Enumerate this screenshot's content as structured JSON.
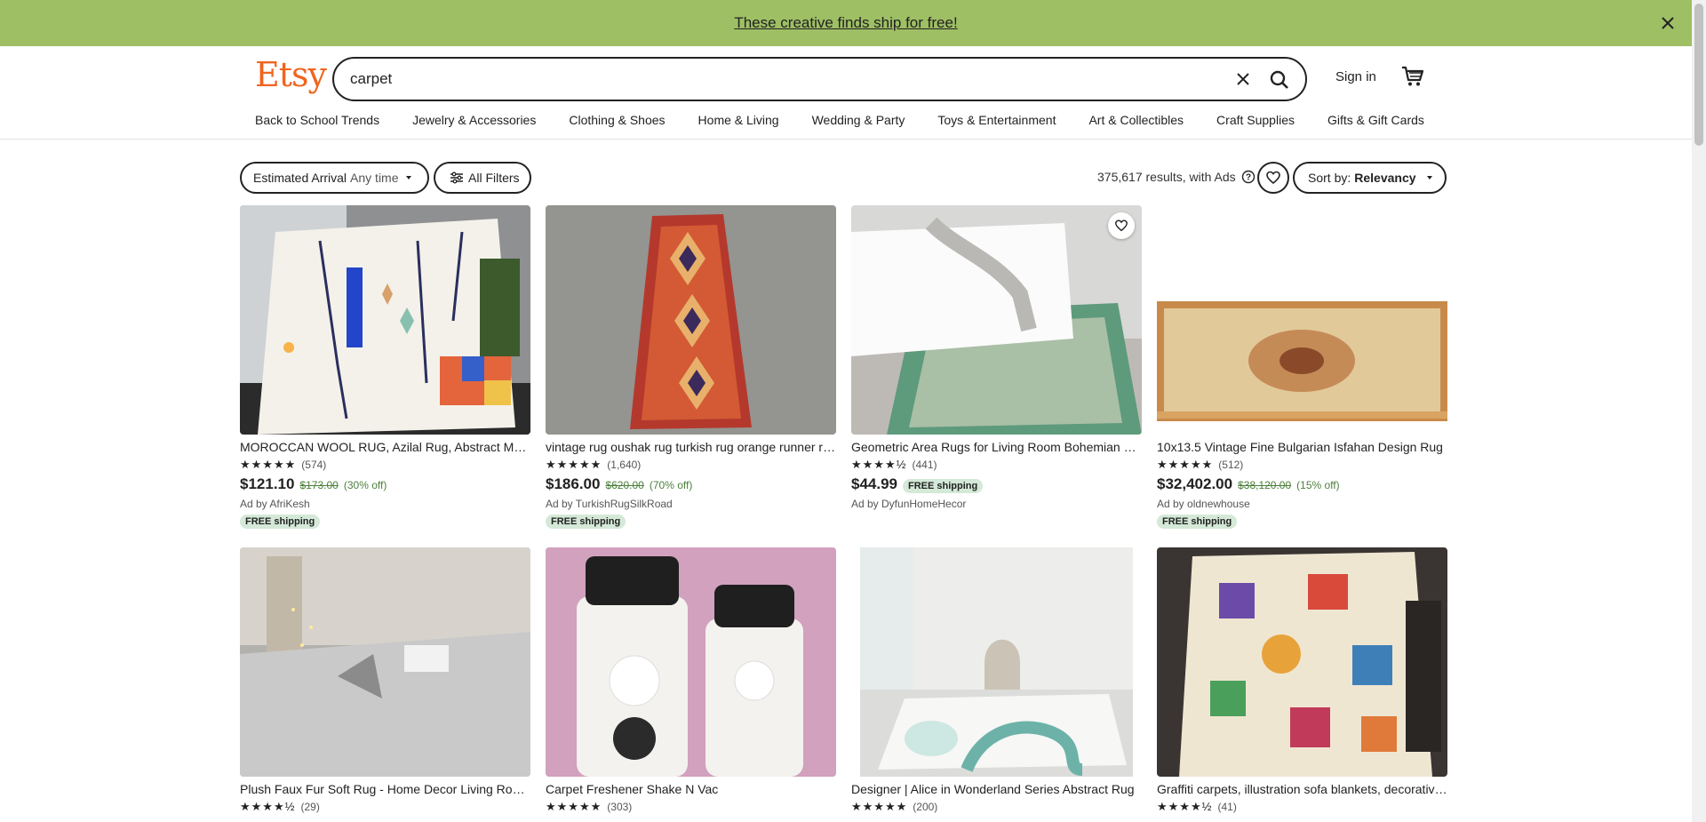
{
  "banner": {
    "text": "These creative finds ship for free!"
  },
  "header": {
    "logo": "Etsy",
    "search_value": "carpet",
    "sign_in": "Sign in"
  },
  "nav": [
    "Back to School Trends",
    "Jewelry & Accessories",
    "Clothing & Shoes",
    "Home & Living",
    "Wedding & Party",
    "Toys & Entertainment",
    "Art & Collectibles",
    "Craft Supplies",
    "Gifts & Gift Cards"
  ],
  "toolbar": {
    "arrival_label": "Estimated Arrival",
    "arrival_value": "Any time",
    "filters_label": "All Filters",
    "results_text": "375,617 results, with Ads",
    "sort_label": "Sort by:",
    "sort_value": "Relevancy"
  },
  "listings": [
    {
      "title": "MOROCCAN WOOL RUG, Azilal Rug, Abstract Moroccan Rug",
      "stars": "★★★★★",
      "reviews": "(574)",
      "price": "$121.10",
      "orig": "$173.00",
      "off": "(30% off)",
      "shop": "Ad by AfriKesh",
      "ship": "FREE shipping",
      "ship_inline": ""
    },
    {
      "title": "vintage rug oushak rug turkish rug orange runner rug",
      "stars": "★★★★★",
      "reviews": "(1,640)",
      "price": "$186.00",
      "orig": "$620.00",
      "off": "(70% off)",
      "shop": "Ad by TurkishRugSilkRoad",
      "ship": "FREE shipping",
      "ship_inline": ""
    },
    {
      "title": "Geometric Area Rugs for Living Room Bohemian Style",
      "stars": "★★★★½",
      "reviews": "(441)",
      "price": "$44.99",
      "orig": "",
      "off": "",
      "shop": "Ad by DyfunHomeHecor",
      "ship": "",
      "ship_inline": "FREE shipping"
    },
    {
      "title": "10x13.5 Vintage Fine Bulgarian Isfahan Design Rug",
      "stars": "★★★★★",
      "reviews": "(512)",
      "price": "$32,402.00",
      "orig": "$38,120.00",
      "off": "(15% off)",
      "shop": "Ad by oldnewhouse",
      "ship": "FREE shipping",
      "ship_inline": ""
    },
    {
      "title": "Plush Faux Fur Soft Rug - Home Decor Living Room Rug",
      "stars": "★★★★½",
      "reviews": "(29)",
      "price": "",
      "orig": "",
      "off": "",
      "shop": "",
      "ship": "",
      "ship_inline": ""
    },
    {
      "title": "Carpet Freshener Shake N Vac",
      "stars": "★★★★★",
      "reviews": "(303)",
      "price": "",
      "orig": "",
      "off": "",
      "shop": "",
      "ship": "",
      "ship_inline": ""
    },
    {
      "title": "Designer | Alice in Wonderland Series Abstract Rug",
      "stars": "★★★★★",
      "reviews": "(200)",
      "price": "",
      "orig": "",
      "off": "",
      "shop": "",
      "ship": "",
      "ship_inline": ""
    },
    {
      "title": "Graffiti carpets, illustration sofa blankets, decorative rugs",
      "stars": "★★★★½",
      "reviews": "(41)",
      "price": "",
      "orig": "",
      "off": "",
      "shop": "",
      "ship": "",
      "ship_inline": ""
    }
  ],
  "colors": {
    "banner": "#9ebf64",
    "brand": "#f1641e",
    "free_shipping_bg": "#d4e9d7",
    "discount": "#4d7f3c"
  }
}
